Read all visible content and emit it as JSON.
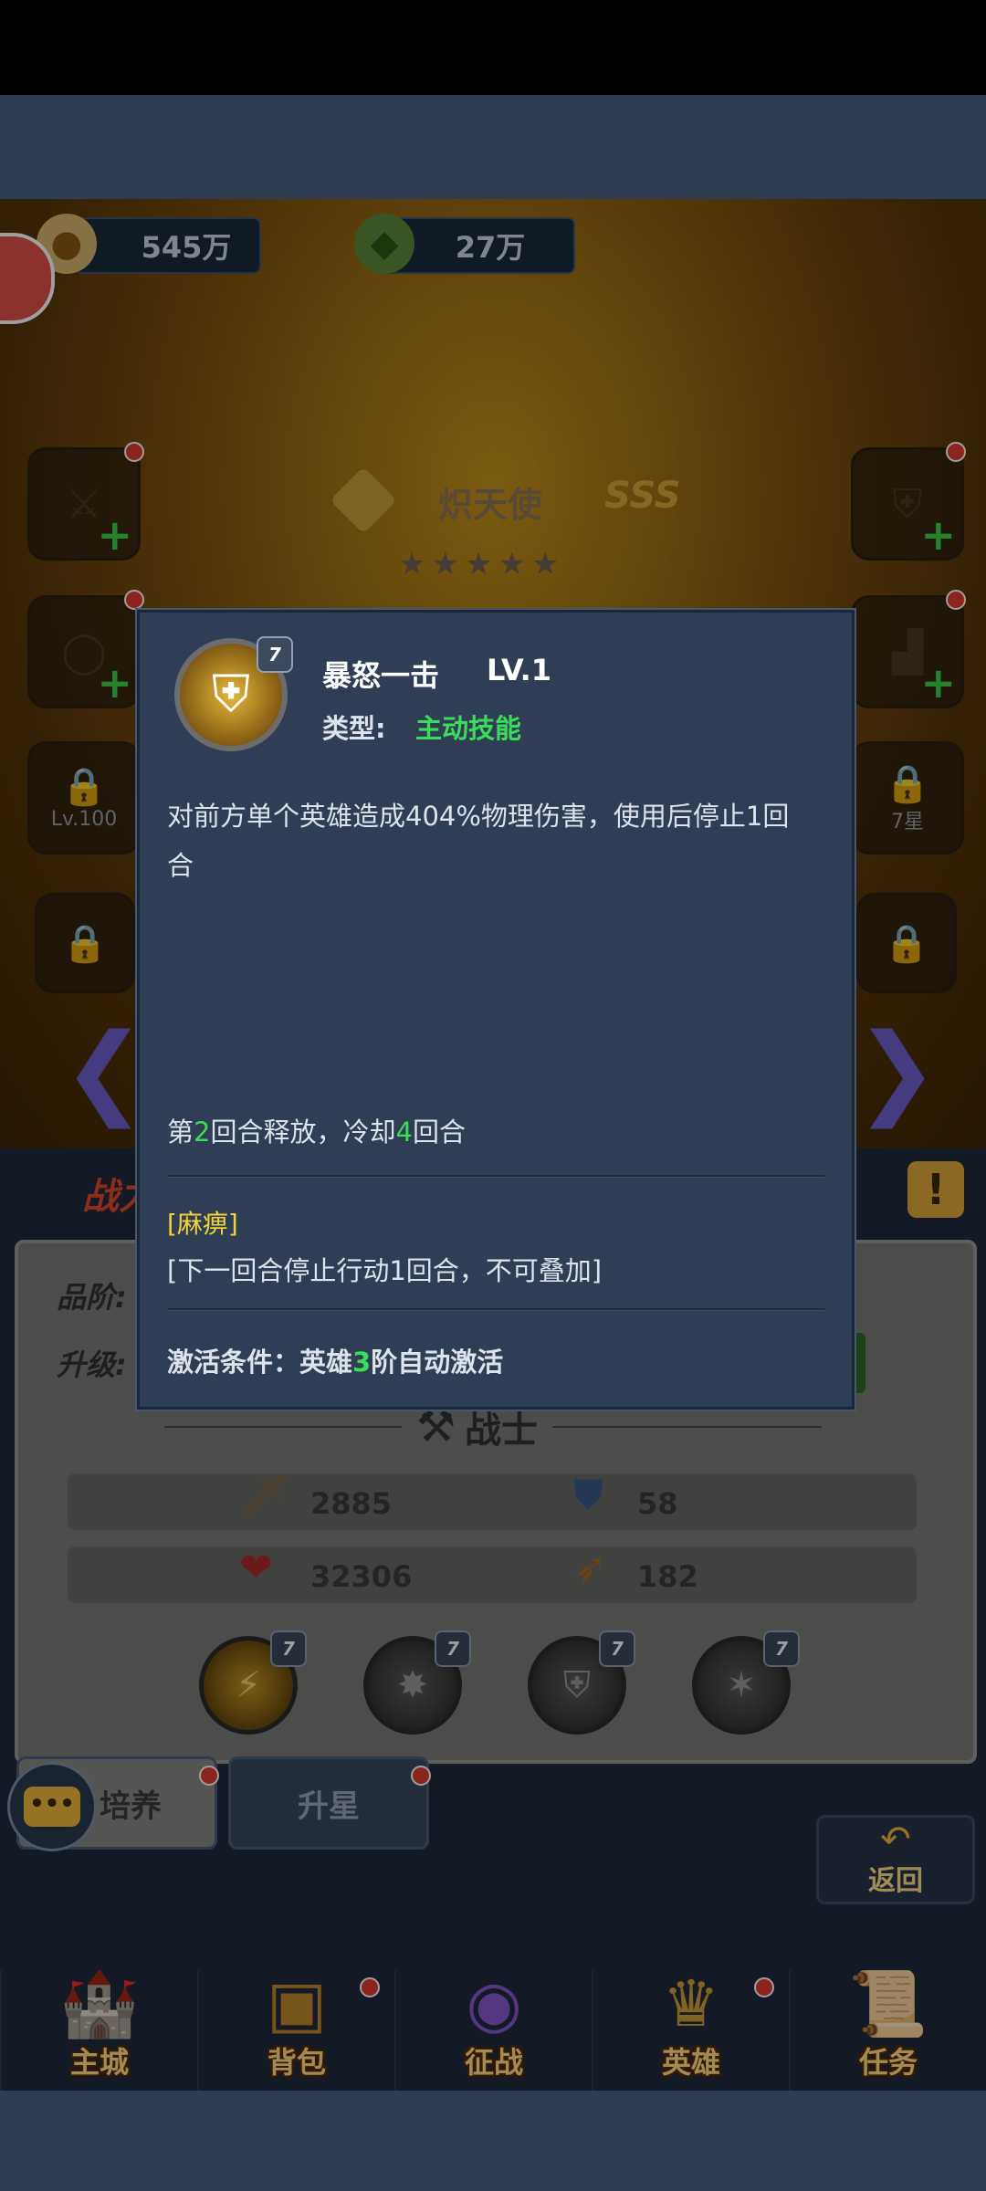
{
  "resources": {
    "gold": {
      "value": "545万",
      "icon": "gold-coin-icon"
    },
    "gem": {
      "value": "27万",
      "icon": "green-gem-icon"
    }
  },
  "hero": {
    "name": "炽天使",
    "grade": "SSS",
    "stars": 5,
    "class_label": "战士"
  },
  "equipment_slots": {
    "left": [
      {
        "name": "weapon-slot",
        "label": ""
      },
      {
        "name": "necklace-slot",
        "label": ""
      },
      {
        "name": "locked-slot-level",
        "label": "Lv.100"
      },
      {
        "name": "locked-slot-4",
        "label": ""
      }
    ],
    "right": [
      {
        "name": "armor-slot",
        "label": ""
      },
      {
        "name": "boots-slot",
        "label": ""
      },
      {
        "name": "locked-slot-star",
        "label": "7星"
      },
      {
        "name": "locked-slot-8",
        "label": ""
      }
    ]
  },
  "panel": {
    "quality_label": "品阶:",
    "upgrade_label": "升级:",
    "title_partial": "战力",
    "stats": {
      "attack": "2885",
      "defense": "58",
      "hp": "32306",
      "speed": "182"
    },
    "skills": [
      {
        "level": "7",
        "active": true
      },
      {
        "level": "7",
        "active": false
      },
      {
        "level": "7",
        "active": false
      },
      {
        "level": "7",
        "active": false
      }
    ]
  },
  "tabs": {
    "train": "培养",
    "star_up": "升星",
    "back": "返回"
  },
  "bottom_nav": [
    {
      "label": "主城",
      "icon": "castle-icon",
      "badge": false
    },
    {
      "label": "背包",
      "icon": "treasure-chest-icon",
      "badge": true
    },
    {
      "label": "征战",
      "icon": "dragon-portal-icon",
      "badge": false
    },
    {
      "label": "英雄",
      "icon": "hero-helmet-icon",
      "badge": true
    },
    {
      "label": "任务",
      "icon": "scroll-icon",
      "badge": false
    }
  ],
  "skill_popup": {
    "icon_level": "7",
    "name": "暴怒一击",
    "level": "LV.1",
    "type_label": "类型:",
    "type_value": "主动技能",
    "description": "对前方单个英雄造成404%物理伤害，使用后停止1回合",
    "release_prefix": "第",
    "release_round": "2",
    "release_mid": "回合释放，冷却",
    "cooldown": "4",
    "release_suffix": "回合",
    "effect_name": "[麻痹]",
    "effect_desc": "[下一回合停止行动1回合，不可叠加]",
    "activate_prefix": "激活条件：英雄",
    "activate_tier": "3",
    "activate_suffix": "阶自动激活"
  },
  "colors": {
    "highlight_green": "#3bdc5a",
    "highlight_yellow": "#f3d23c",
    "popup_bg": "#2f3e54"
  }
}
